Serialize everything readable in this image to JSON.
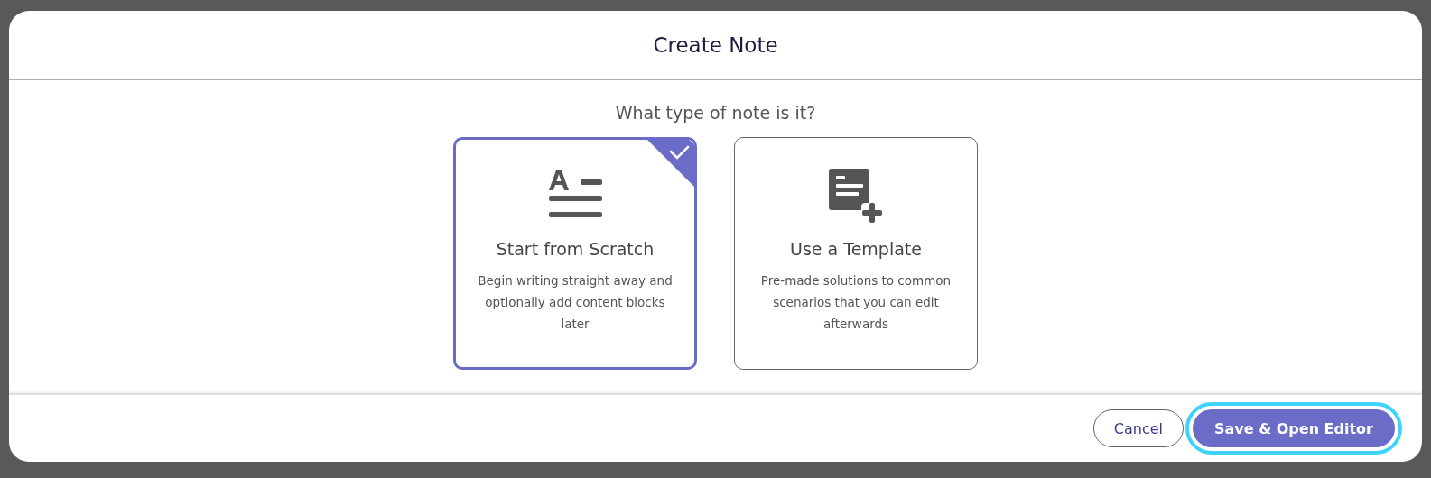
{
  "dialog": {
    "title": "Create Note",
    "question": "What type of note is it?",
    "options": [
      {
        "kind": "scratch",
        "title": "Start from Scratch",
        "description": "Begin writing straight away and optionally add content blocks later",
        "selected": true
      },
      {
        "kind": "template",
        "title": "Use a Template",
        "description": "Pre-made solutions to common scenarios that you can edit afterwards",
        "selected": false
      }
    ],
    "buttons": [
      {
        "kind": "secondary",
        "label": "Cancel",
        "focused": false
      },
      {
        "kind": "primary",
        "label": "Save & Open Editor",
        "focused": true
      }
    ]
  }
}
